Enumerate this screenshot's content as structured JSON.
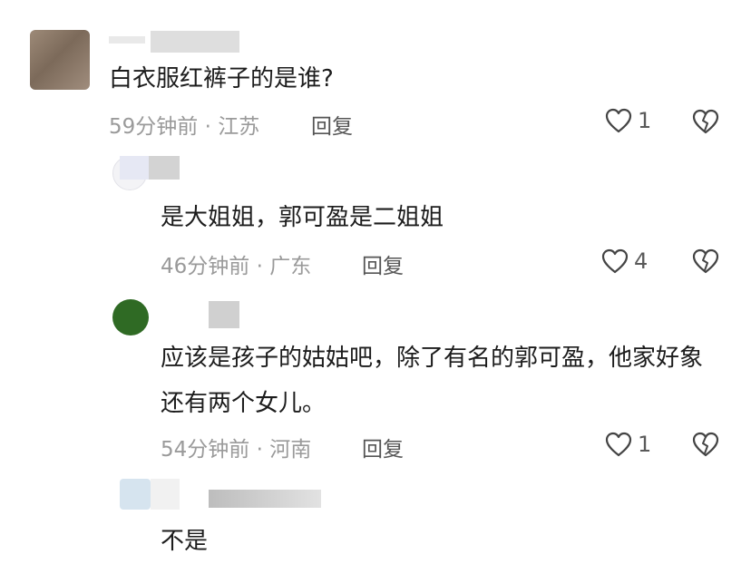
{
  "comments": [
    {
      "text": "白衣服红裤子的是谁?",
      "time_location": "59分钟前 · 江苏",
      "reply_label": "回复",
      "likes": "1"
    },
    {
      "text": "是大姐姐，郭可盈是二姐姐",
      "time_location": "46分钟前 · 广东",
      "reply_label": "回复",
      "likes": "4"
    },
    {
      "text": "应该是孩子的姑姑吧，除了有名的郭可盈，他家好象还有两个女儿。",
      "time_location": "54分钟前 · 河南",
      "reply_label": "回复",
      "likes": "1"
    },
    {
      "text": "不是"
    }
  ],
  "icons": {
    "like": "heart-outline-icon",
    "dislike": "broken-heart-outline-icon"
  },
  "colors": {
    "text": "#1c1c1c",
    "meta": "#9a9a9a",
    "reply": "#555555"
  }
}
